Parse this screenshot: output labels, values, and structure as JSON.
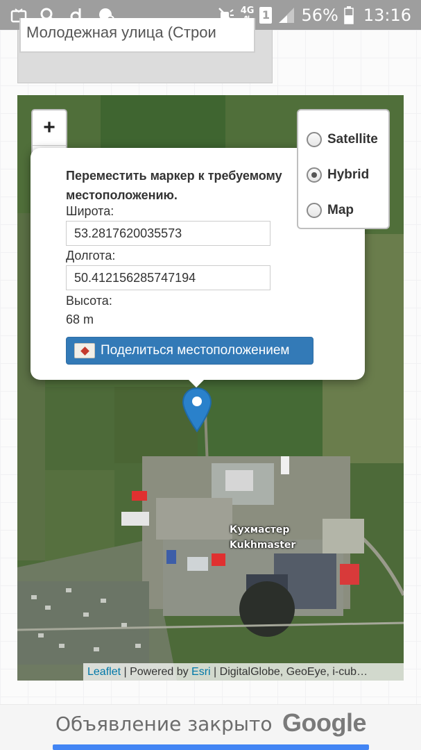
{
  "status_bar": {
    "network_badge": "4G",
    "sim_badge": "1",
    "battery_percent": "56%",
    "time": "13:16",
    "icons_left": [
      "screenshot-icon",
      "search-icon",
      "app-d-icon",
      "chat-icon"
    ],
    "icons_right": [
      "mute-icon",
      "network-4g-icon",
      "sim-1-icon",
      "signal-icon",
      "battery-icon"
    ]
  },
  "address": {
    "value": "Молодежная улица (Строи"
  },
  "map": {
    "zoom_in": "+",
    "zoom_out": "−",
    "layers": [
      {
        "label": "Satellite",
        "checked": false
      },
      {
        "label": "Hybrid",
        "checked": true
      },
      {
        "label": "Map",
        "checked": false
      }
    ],
    "popup": {
      "title": "Переместить маркер к требуемому местоположению.",
      "lat_label": "Широта:",
      "lat_value": "53.2817620035573",
      "lon_label": "Долгота:",
      "lon_value": "50.412156285747194",
      "alt_label": "Высота:",
      "alt_value": "68 m",
      "share_button": "Поделиться местоположением"
    },
    "place_label_ru": "Кухмастер",
    "place_label_en": "Kukhmaster",
    "attribution": {
      "leaflet": "Leaflet",
      "sep1": " | Powered by ",
      "esri": "Esri",
      "rest": " | DigitalGlobe, GeoEye, i-cub…"
    }
  },
  "ad": {
    "text": "Объявление закрыто",
    "brand": "Google"
  },
  "colors": {
    "status_bar": "#9e9e9e",
    "share_button": "#337ab7",
    "marker": "#2a81cb",
    "link": "#0078a8",
    "ad_button": "#4285f4"
  }
}
